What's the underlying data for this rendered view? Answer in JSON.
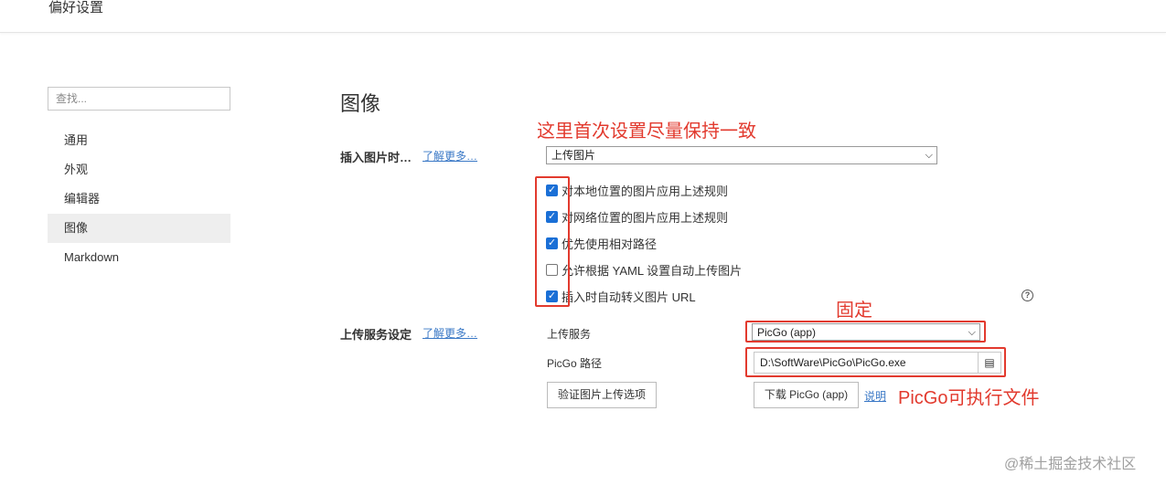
{
  "window": {
    "title": "偏好设置"
  },
  "search": {
    "placeholder": "查找..."
  },
  "sidebar": {
    "items": [
      {
        "label": "通用",
        "active": false
      },
      {
        "label": "外观",
        "active": false
      },
      {
        "label": "编辑器",
        "active": false
      },
      {
        "label": "图像",
        "active": true
      },
      {
        "label": "Markdown",
        "active": false
      }
    ]
  },
  "main": {
    "section_title": "图像",
    "insert": {
      "label": "插入图片时…",
      "learn_more": "了解更多…",
      "select_value": "上传图片",
      "options": [
        {
          "label": "对本地位置的图片应用上述规则",
          "checked": true
        },
        {
          "label": "对网络位置的图片应用上述规则",
          "checked": true
        },
        {
          "label": "优先使用相对路径",
          "checked": true
        },
        {
          "label": "允许根据 YAML 设置自动上传图片",
          "checked": false
        },
        {
          "label": "插入时自动转义图片 URL",
          "checked": true
        }
      ],
      "help_glyph": "?"
    },
    "upload": {
      "label": "上传服务设定",
      "learn_more": "了解更多…",
      "service_label": "上传服务",
      "service_value": "PicGo (app)",
      "path_label": "PicGo 路径",
      "path_value": "D:\\SoftWare\\PicGo\\PicGo.exe",
      "verify_button": "验证图片上传选项",
      "download_button": "下载 PicGo (app)",
      "docs_link": "说明"
    }
  },
  "annotations": {
    "note_first": "这里首次设置尽量保持一致",
    "note_fixed": "固定",
    "note_exe": "PicGo可执行文件",
    "color": "#e23a2e"
  },
  "watermark": "@稀土掘金技术社区",
  "icons": {
    "dropdown": "chevron-down-icon",
    "folder": "folder-icon",
    "help": "help-circle-icon",
    "check": "check-icon"
  }
}
